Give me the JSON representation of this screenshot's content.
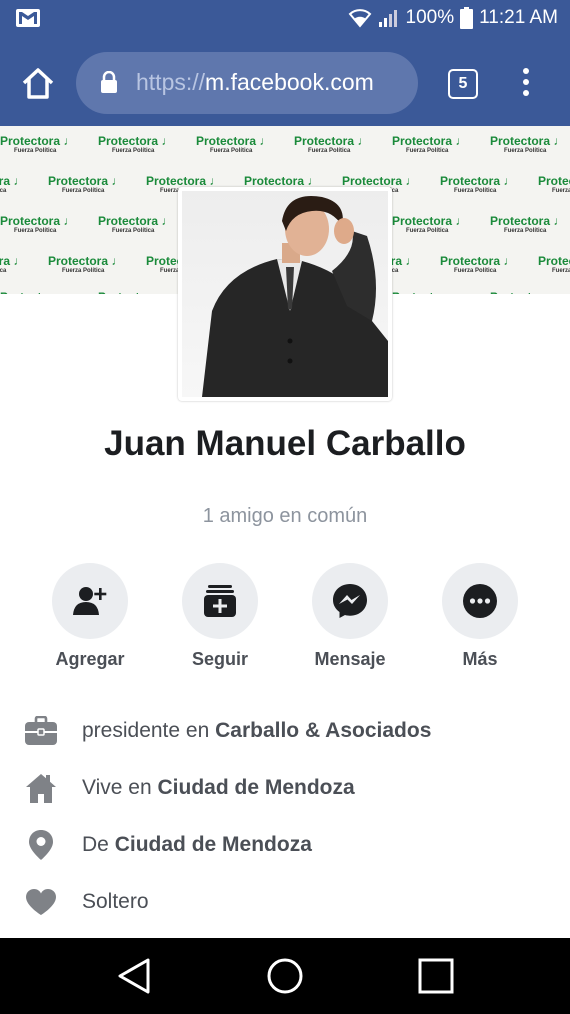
{
  "status": {
    "battery": "100%",
    "time": "11:21 AM"
  },
  "browser": {
    "url_prefix": "https://",
    "url_domain": "m.facebook.com",
    "tab_count": "5"
  },
  "cover": {
    "watermark_brand": "Protectora",
    "watermark_sub": "Fuerza Política"
  },
  "profile": {
    "name": "Juan Manuel Carballo",
    "mutual": "1 amigo en común"
  },
  "actions": {
    "add": "Agregar",
    "follow": "Seguir",
    "message": "Mensaje",
    "more": "Más"
  },
  "about": {
    "work_prefix": "presidente en",
    "work_place": "Carballo & Asociados",
    "lives_prefix": "Vive en",
    "lives_place": "Ciudad de Mendoza",
    "from_prefix": "De",
    "from_place": "Ciudad de Mendoza",
    "relationship": "Soltero"
  },
  "colors": {
    "brand": "#3b5998",
    "icon_gray": "#1c1e21",
    "text_gray": "#4b4f56"
  }
}
